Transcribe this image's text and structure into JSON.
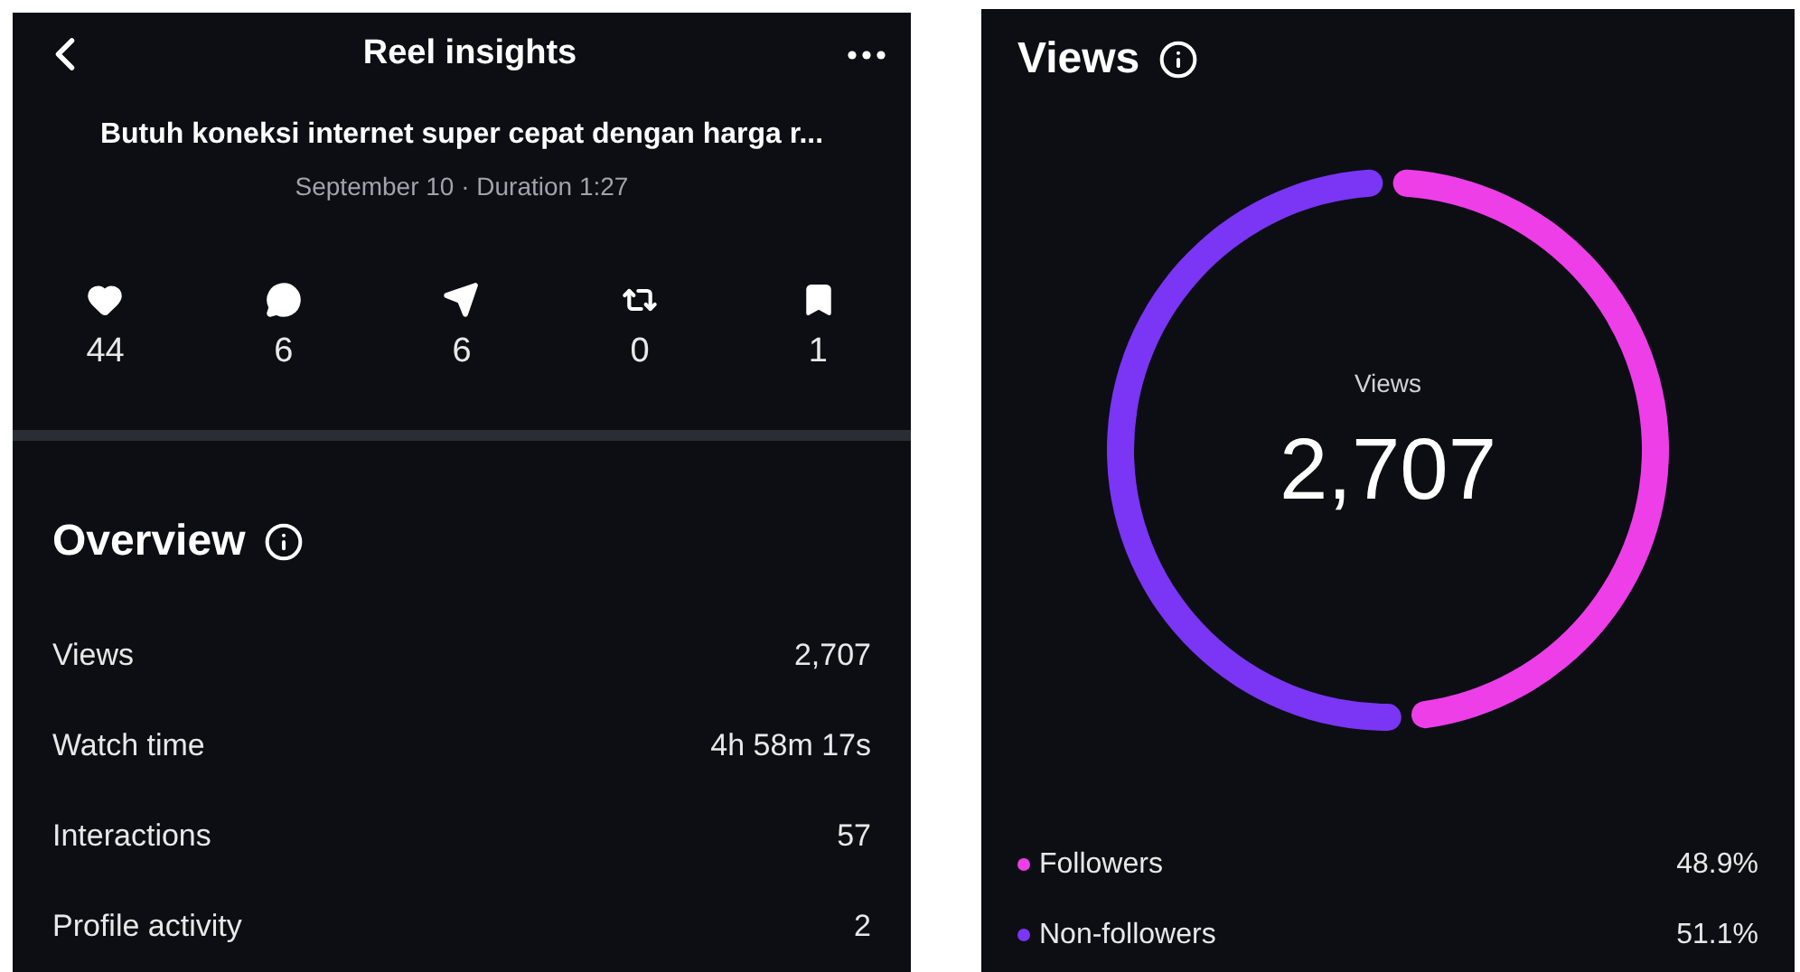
{
  "insights": {
    "title": "Reel insights",
    "reel_title": "Butuh koneksi internet super cepat dengan harga r...",
    "subtitle": "September 10 · Duration 1:27",
    "stats": [
      {
        "kind": "likes",
        "count": "44"
      },
      {
        "kind": "comments",
        "count": "6"
      },
      {
        "kind": "shares",
        "count": "6"
      },
      {
        "kind": "reposts",
        "count": "0"
      },
      {
        "kind": "saves",
        "count": "1"
      }
    ],
    "overview": {
      "heading": "Overview",
      "rows": [
        {
          "label": "Views",
          "value": "2,707"
        },
        {
          "label": "Watch time",
          "value": "4h 58m 17s"
        },
        {
          "label": "Interactions",
          "value": "57"
        },
        {
          "label": "Profile activity",
          "value": "2"
        }
      ]
    }
  },
  "views": {
    "heading": "Views",
    "center_label": "Views",
    "center_value": "2,707",
    "chart_data": {
      "type": "donut",
      "categories": [
        "Followers",
        "Non-followers"
      ],
      "values": [
        48.9,
        51.1
      ]
    },
    "legend": [
      {
        "value": "48.9%",
        "color": "#ee3ee8"
      },
      {
        "value": "51.1%",
        "color": "#7b35f5"
      }
    ]
  }
}
